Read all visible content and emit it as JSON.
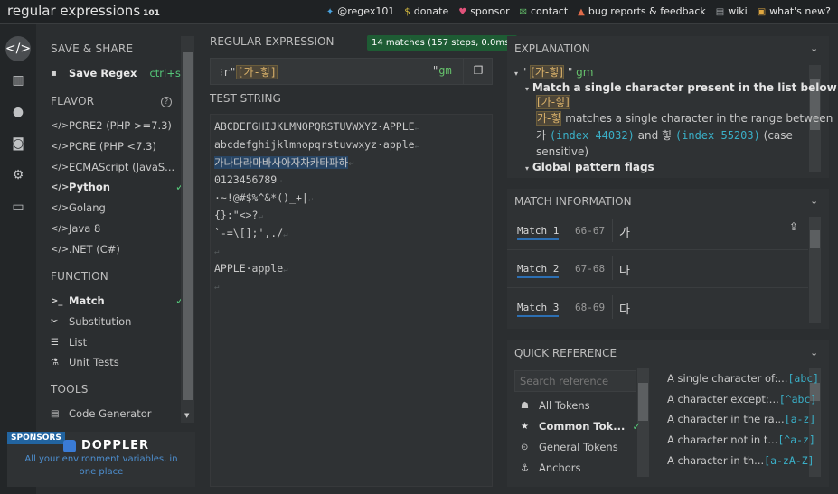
{
  "header": {
    "logo_main": "regular",
    "logo_bold": "expressions",
    "logo_version": "101",
    "links": [
      {
        "icon": "twitter-icon",
        "glyph": "🐦",
        "label": "@regex101"
      },
      {
        "icon": "dollar-icon",
        "glyph": "$",
        "label": "donate"
      },
      {
        "icon": "heart-icon",
        "glyph": "♥",
        "label": "sponsor"
      },
      {
        "icon": "mail-icon",
        "glyph": "✉",
        "label": "contact"
      },
      {
        "icon": "warning-icon",
        "glyph": "▲",
        "label": "bug reports & feedback"
      },
      {
        "icon": "book-icon",
        "glyph": "▤",
        "label": "wiki"
      },
      {
        "icon": "news-icon",
        "glyph": "▣",
        "label": "what's new?"
      }
    ]
  },
  "sidebar": {
    "save_share_title": "SAVE & SHARE",
    "save_regex_label": "Save Regex",
    "save_regex_shortcut": "ctrl+s",
    "flavor_title": "FLAVOR",
    "flavors": [
      "PCRE2 (PHP >=7.3)",
      "PCRE (PHP <7.3)",
      "ECMAScript (JavaS...",
      "Python",
      "Golang",
      "Java 8",
      ".NET (C#)"
    ],
    "selected_flavor": "Python",
    "function_title": "FUNCTION",
    "functions": [
      "Match",
      "Substitution",
      "List",
      "Unit Tests"
    ],
    "selected_function": "Match",
    "tools_title": "TOOLS",
    "tools": [
      "Code Generator"
    ]
  },
  "sponsor": {
    "tag": "SPONSORS",
    "name": "DOPPLER",
    "tagline": "All your environment variables, in one place"
  },
  "regex": {
    "title": "REGULAR EXPRESSION",
    "badge": "14 matches (157 steps, 0.0ms)",
    "prefix": "r\"",
    "pattern": "[가-힣]",
    "suffix": "\"",
    "flags": "gm"
  },
  "test_string": {
    "title": "TEST STRING",
    "lines": [
      "ABCDEFGHIJKLMNOPQRSTUVWXYZ·APPLE",
      "abcdefghijklmnopqrstuvwxyz·apple",
      "가나다라마바사아자차카타파하",
      "0123456789",
      "·~!@#$%^&*()_+|",
      "{}:\"<>?",
      "`-=\\[];',./",
      "",
      "APPLE·apple",
      ""
    ]
  },
  "explanation": {
    "title": "EXPLANATION",
    "regex_line_prefix": "\"",
    "regex_line_pattern": "[가-힣]",
    "regex_line_suffix": "\"",
    "regex_line_flags": "gm",
    "item1_bold": "Match a single character present in the list below",
    "item1_pattern": "[가-힣]",
    "range_text": "가-힣",
    "range_desc": "matches a single character in the range between",
    "from_char": "가",
    "from_index": "(index 44032)",
    "and": "and",
    "to_char": "힣",
    "to_index": "(index 55203)",
    "case_note": "(case",
    "case_note2": "sensitive)",
    "item2_bold": "Global pattern flags"
  },
  "match_info": {
    "title": "MATCH INFORMATION",
    "matches": [
      {
        "label": "Match 1",
        "range": "66-67",
        "text": "가"
      },
      {
        "label": "Match 2",
        "range": "67-68",
        "text": "나"
      },
      {
        "label": "Match 3",
        "range": "68-69",
        "text": "다"
      }
    ]
  },
  "quick_ref": {
    "title": "QUICK REFERENCE",
    "search_placeholder": "Search reference",
    "categories": [
      {
        "icon": "tokens-icon",
        "glyph": "☗",
        "label": "All Tokens"
      },
      {
        "icon": "star-icon",
        "glyph": "★",
        "label": "Common Tok..."
      },
      {
        "icon": "circle-icon",
        "glyph": "⊙",
        "label": "General Tokens"
      },
      {
        "icon": "anchor-icon",
        "glyph": "⚓",
        "label": "Anchors"
      }
    ],
    "selected_category": "Common Tok...",
    "entries": [
      {
        "desc": "A single character of:...",
        "token": "[abc]"
      },
      {
        "desc": "A character except:...",
        "token": "[^abc]"
      },
      {
        "desc": "A character in the ra...",
        "token": "[a-z]"
      },
      {
        "desc": "A character not in t...",
        "token": "[^a-z]"
      },
      {
        "desc": "A character in th...",
        "token": "[a-zA-Z]"
      }
    ]
  }
}
